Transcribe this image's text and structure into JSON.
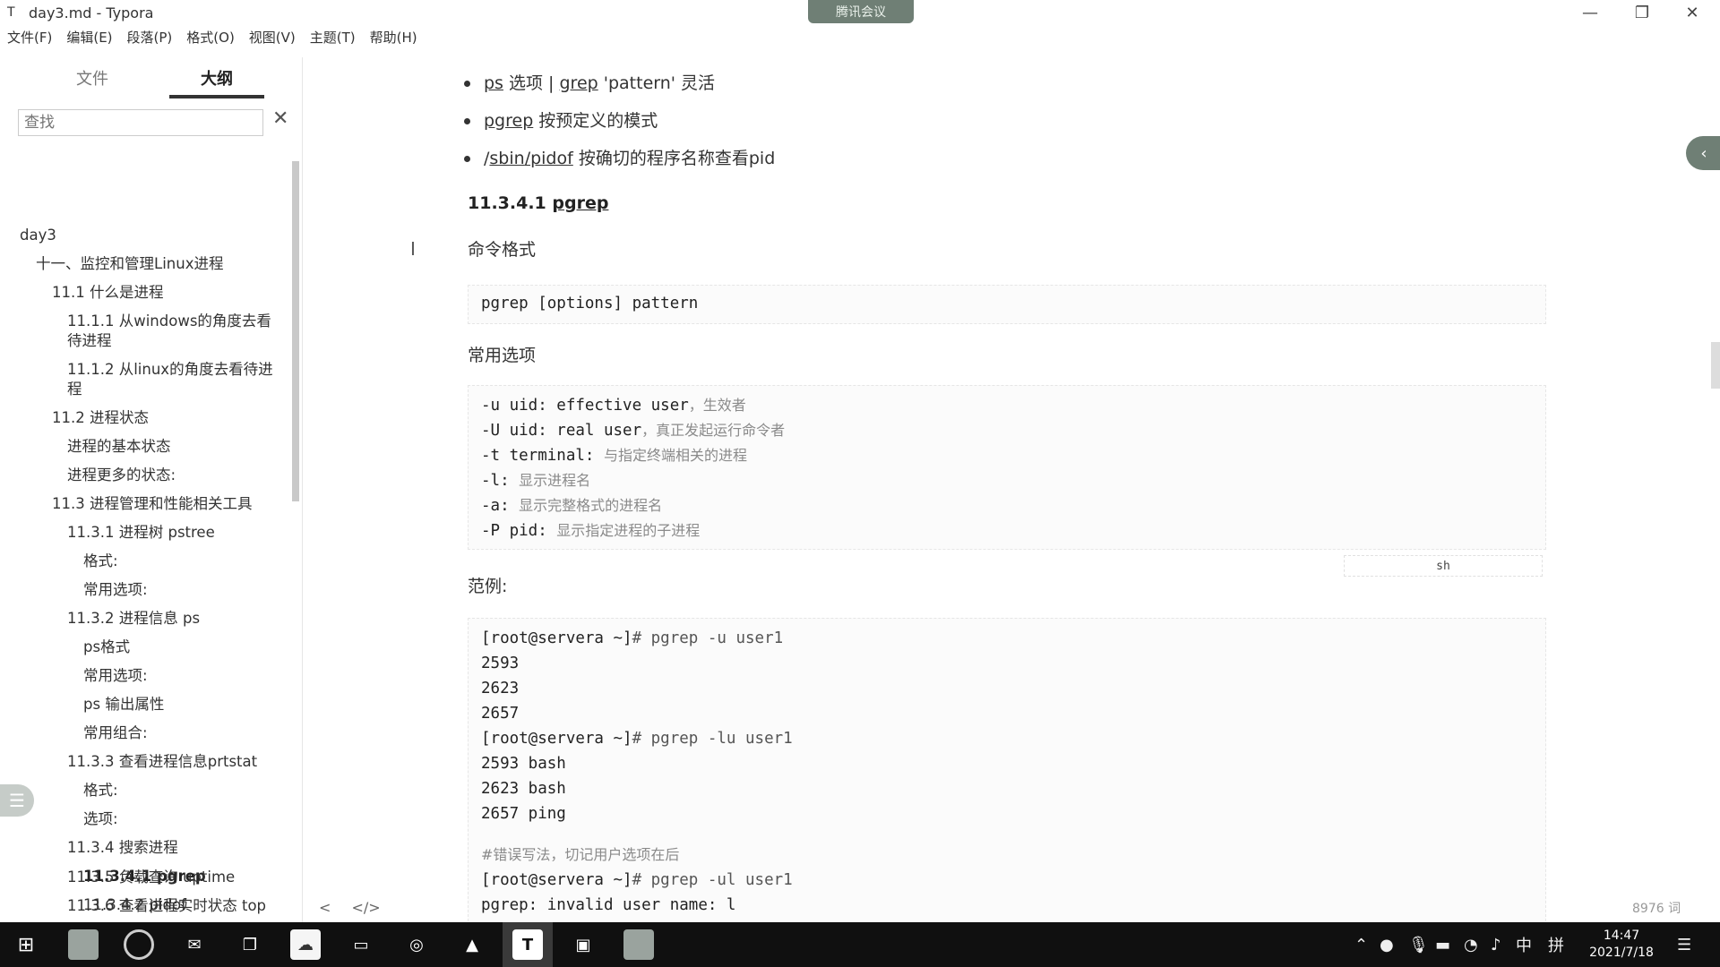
{
  "window": {
    "title": "day3.md - Typora",
    "app_icon": "T",
    "meeting_label": "腾讯会议"
  },
  "menu": [
    "文件(F)",
    "编辑(E)",
    "段落(P)",
    "格式(O)",
    "视图(V)",
    "主题(T)",
    "帮助(H)"
  ],
  "sidebar": {
    "tabs": [
      "文件",
      "大纲"
    ],
    "search_placeholder": "查找",
    "outline": [
      "day3",
      "十一、监控和管理Linux进程",
      "11.1 什么是进程",
      "11.1.1 从windows的角度去看待进程",
      "11.1.2 从linux的角度去看待进程",
      "11.2 进程状态",
      "进程的基本状态",
      "进程更多的状态:",
      "11.3 进程管理和性能相关工具",
      "11.3.1 进程树 pstree",
      "格式:",
      "常用选项:",
      "11.3.2 进程信息 ps",
      "ps格式",
      "常用选项:",
      "ps 输出属性",
      "常用组合:",
      "11.3.3 查看进程信息prtstat",
      "格式:",
      "选项:",
      "11.3.4 搜索进程",
      "11.3.4.1 pgrep",
      "11.3.4.2 pidof",
      "11.3.5 负载查询 uptime",
      "11.3.6 查看进程实时状态 top"
    ]
  },
  "content": {
    "bullets": [
      {
        "a": "ps",
        "b": " 选项 | ",
        "c": "grep",
        "d": " 'pattern' 灵活"
      },
      {
        "a": "pgrep",
        "b": " 按预定义的模式",
        "c": "",
        "d": ""
      },
      {
        "a": "/",
        "b": "sbin",
        "c": "/pidof",
        "d": " 按确切的程序名称查看pid"
      }
    ],
    "heading": "11.3.4.1 pgrep",
    "heading_prefix": "11.3.4.1 ",
    "heading_word": "pgrep",
    "label_format": "命令格式",
    "code_format": "pgrep [options] pattern",
    "label_options": "常用选项",
    "options": [
      {
        "code": "-u uid: effective user",
        "cmt": "，生效者"
      },
      {
        "code": "-U uid: real user",
        "cmt": "，真正发起运行命令者"
      },
      {
        "code": "-t terminal: ",
        "cmt": "与指定终端相关的进程"
      },
      {
        "code": "-l: ",
        "cmt": "显示进程名"
      },
      {
        "code": "-a: ",
        "cmt": "显示完整格式的进程名"
      },
      {
        "code": "-P pid: ",
        "cmt": "显示指定进程的子进程"
      }
    ],
    "code_lang": "sh",
    "label_example": "范例:",
    "example_lines": [
      {
        "prompt": "[root@servera ~]",
        "rest": "# pgrep -u user1"
      },
      {
        "prompt": "",
        "rest": "2593"
      },
      {
        "prompt": "",
        "rest": "2623"
      },
      {
        "prompt": "",
        "rest": "2657"
      },
      {
        "prompt": "[root@servera ~]",
        "rest": "# pgrep -lu user1"
      },
      {
        "prompt": "",
        "rest": "2593 bash"
      },
      {
        "prompt": "",
        "rest": "2623 bash"
      },
      {
        "prompt": "",
        "rest": "2657 ping"
      },
      {
        "prompt": "",
        "rest": ""
      },
      {
        "prompt": "",
        "rest": "#错误写法，切记用户选项在后"
      },
      {
        "prompt": "[root@servera ~]",
        "rest": "# pgrep -ul user1"
      },
      {
        "prompt": "",
        "rest": "pgrep: invalid user name: l"
      }
    ],
    "word_count": "8976 词",
    "footer_icons": [
      "<",
      "</>"
    ]
  },
  "taskbar": {
    "clock_time": "14:47",
    "clock_date": "2021/7/18",
    "ime": "中",
    "ime2": "拼"
  }
}
